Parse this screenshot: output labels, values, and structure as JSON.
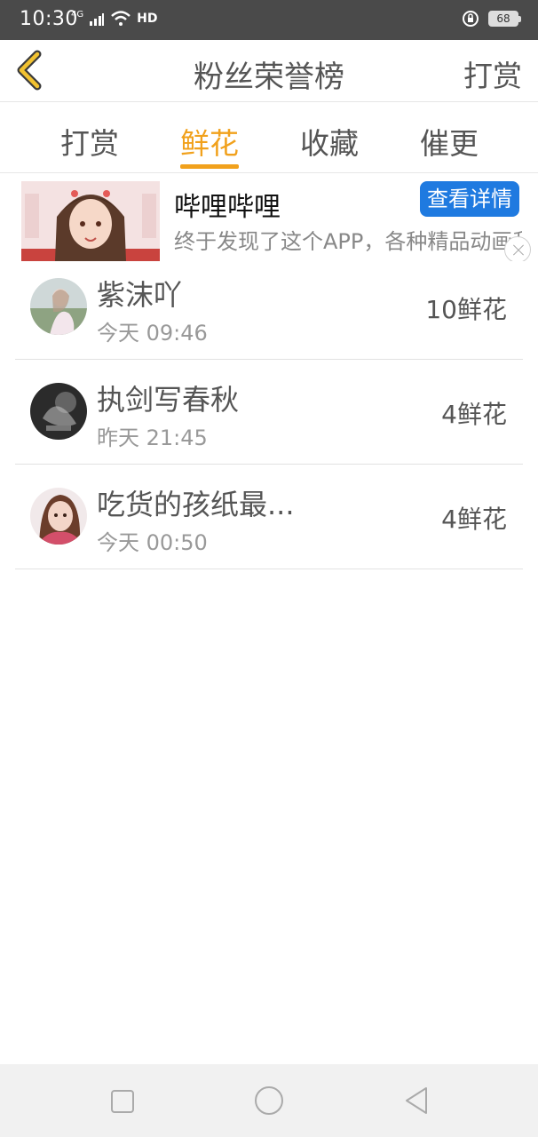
{
  "status_bar": {
    "time": "10:30",
    "network": "4G",
    "hd": "HD",
    "battery": "68"
  },
  "header": {
    "title": "粉丝荣誉榜",
    "action": "打赏"
  },
  "tabs": [
    {
      "label": "打赏",
      "active": false
    },
    {
      "label": "鲜花",
      "active": true
    },
    {
      "label": "收藏",
      "active": false
    },
    {
      "label": "催更",
      "active": false
    }
  ],
  "ad": {
    "title": "哔哩哔哩",
    "description": "终于发现了这个APP，各种精品动画和视频，无广告，一次看过瘾",
    "button": "查看详情"
  },
  "list": [
    {
      "name": "紫沫吖",
      "time": "今天 09:46",
      "amount": "10鲜花"
    },
    {
      "name": "执剑写春秋",
      "time": "昨天 21:45",
      "amount": "4鲜花"
    },
    {
      "name": "吃货的孩纸最...",
      "time": "今天 00:50",
      "amount": "4鲜花"
    }
  ],
  "colors": {
    "accent": "#f1a11c",
    "ad_button": "#1f7ae0",
    "status_bar": "#4a4a4a"
  }
}
